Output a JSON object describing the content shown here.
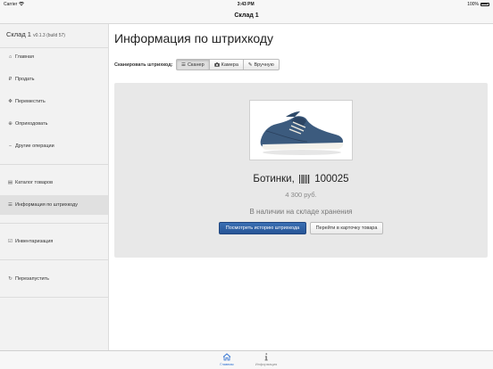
{
  "status_bar": {
    "carrier": "Carrier",
    "time": "3:43 PM",
    "battery": "100%"
  },
  "nav": {
    "title": "Склад 1"
  },
  "sidebar": {
    "app_name": "Склад 1",
    "version": "v0.1.3 (build 57)",
    "items": [
      {
        "label": "Главная",
        "icon": "home-icon"
      },
      {
        "label": "Продать",
        "icon": "ruble-icon"
      },
      {
        "label": "Переместить",
        "icon": "move-icon"
      },
      {
        "label": "Оприходовать",
        "icon": "plus-circle-icon"
      },
      {
        "label": "Другие операции",
        "icon": "minus-icon"
      },
      {
        "label": "Каталог товаров",
        "icon": "catalog-icon"
      },
      {
        "label": "Информация по штрихкоду",
        "icon": "list-icon"
      },
      {
        "label": "Инвентаризация",
        "icon": "check-square-icon"
      },
      {
        "label": "Перезапустить",
        "icon": "refresh-icon"
      }
    ],
    "active_index": 6
  },
  "main": {
    "title": "Информация по штрихкоду",
    "scan_label": "Сканировать штрихкод:",
    "scan_modes": [
      {
        "label": "Сканер",
        "icon": "barcode-list-icon",
        "selected": true
      },
      {
        "label": "Камера",
        "icon": "camera-icon",
        "selected": false
      },
      {
        "label": "Вручную",
        "icon": "edit-icon",
        "selected": false
      }
    ]
  },
  "product": {
    "name": "Ботинки,",
    "code": "100025",
    "price": "4 300 руб.",
    "stock_status": "В наличии на складе хранения",
    "history_button": "Посмотреть историю штрихкода",
    "card_button": "Перейти в карточку товара"
  },
  "tabbar": {
    "tabs": [
      {
        "label": "Главная",
        "icon": "home-icon",
        "active": true
      },
      {
        "label": "Информация",
        "icon": "info-icon",
        "active": false
      }
    ]
  },
  "colors": {
    "accent": "#2d6fd0",
    "primary_button": "#2e5fa3"
  }
}
